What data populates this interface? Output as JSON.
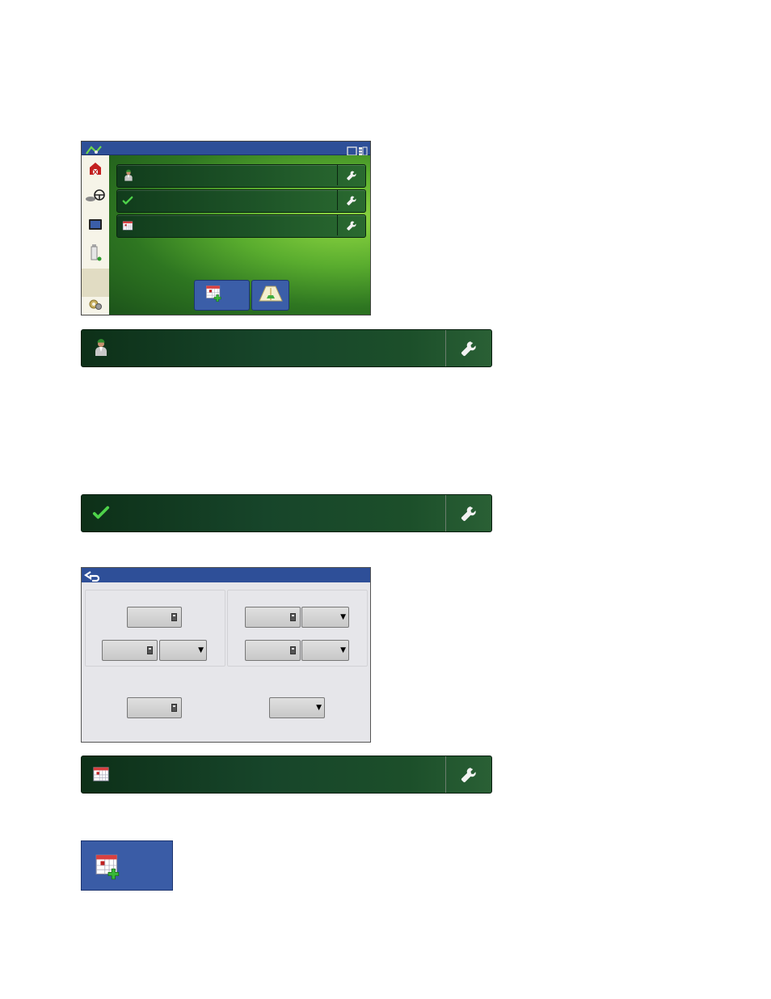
{
  "home_screen": {
    "sidebar_icons": [
      "barn-icon",
      "steering-wheel-icon",
      "display-icon",
      "product-bottle-icon",
      "",
      "settings-gear-icon"
    ],
    "setup_bars": [
      {
        "icon": "operator-icon",
        "tool_icon": "wrench-icon"
      },
      {
        "icon": "checkmark-icon",
        "tool_icon": "wrench-icon"
      },
      {
        "icon": "calendar-icon",
        "tool_icon": "wrench-icon"
      }
    ],
    "bottom_buttons": [
      {
        "icon": "new-event-calendar-icon"
      },
      {
        "icon": "field-guidance-icon"
      }
    ]
  },
  "operator_bar": {
    "icon": "operator-icon",
    "tool_icon": "wrench-icon"
  },
  "checklist_bar": {
    "icon": "checkmark-icon",
    "tool_icon": "wrench-icon"
  },
  "settings_dialog": {
    "back_icon": "back-arrow-icon",
    "fields": [
      "calculator-field",
      "calculator-field",
      "dropdown",
      "calculator-field",
      "dropdown",
      "calculator-field",
      "dropdown",
      "calculator-field",
      "dropdown"
    ]
  },
  "event_bar": {
    "icon": "calendar-icon",
    "tool_icon": "wrench-icon"
  },
  "new_event_button": {
    "icon": "new-event-calendar-icon"
  },
  "colors": {
    "blue": "#3b5ea8",
    "title_blue": "#2e4f98",
    "green_dark": "#113c1c",
    "green_light": "#8fd742"
  }
}
